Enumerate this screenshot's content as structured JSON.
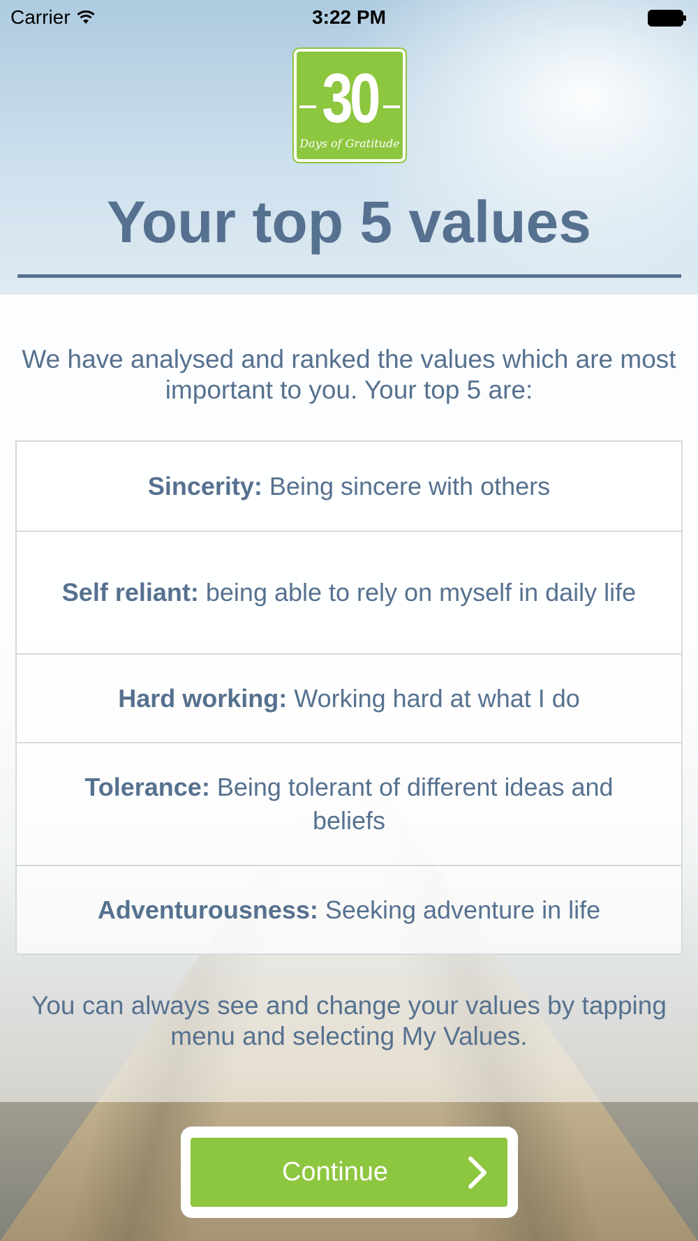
{
  "status_bar": {
    "carrier": "Carrier",
    "time": "3:22 PM"
  },
  "logo": {
    "number": "30",
    "subtitle": "Days of Gratitude"
  },
  "header": {
    "title": "Your top 5 values"
  },
  "intro": "We have analysed and ranked the values which are most important to you. Your top 5 are:",
  "values": [
    {
      "name": "Sincerity:",
      "description": "Being sincere with others"
    },
    {
      "name": "Self reliant:",
      "description": "being able to rely on myself in daily life"
    },
    {
      "name": "Hard working:",
      "description": "Working hard at what I do"
    },
    {
      "name": "Tolerance:",
      "description": "Being tolerant of different ideas and beliefs"
    },
    {
      "name": "Adventurousness:",
      "description": "Seeking adventure in life"
    }
  ],
  "footer_note": "You can always see and change your values by tapping menu and selecting My Values.",
  "continue_button": {
    "label": "Continue",
    "icon": "chevron-right-icon"
  },
  "colors": {
    "accent_green": "#8dc63f",
    "text_slate": "#56718f"
  }
}
